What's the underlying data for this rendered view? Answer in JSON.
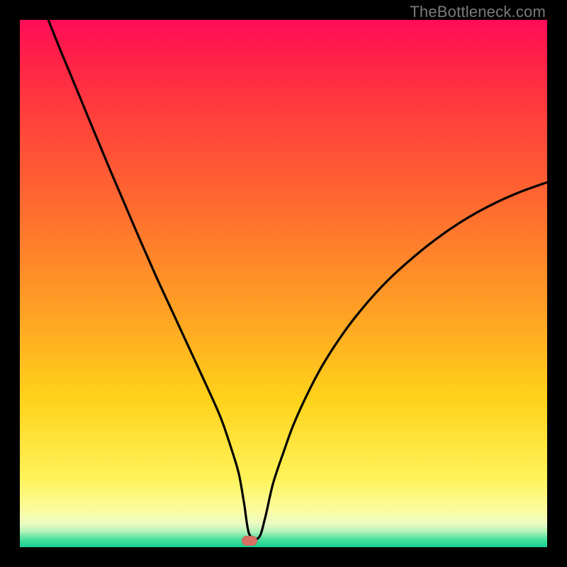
{
  "watermark": "TheBottleneck.com",
  "marker": {
    "x_frac": 0.435,
    "y_frac": 0.988
  },
  "chart_data": {
    "type": "line",
    "title": "",
    "xlabel": "",
    "ylabel": "",
    "xlim": [
      0,
      1
    ],
    "ylim": [
      0,
      1
    ],
    "series": [
      {
        "name": "curve",
        "x": [
          0.054,
          0.08,
          0.11,
          0.14,
          0.17,
          0.2,
          0.23,
          0.26,
          0.29,
          0.32,
          0.35,
          0.38,
          0.4,
          0.415,
          0.425,
          0.435,
          0.453,
          0.465,
          0.48,
          0.5,
          0.52,
          0.55,
          0.58,
          0.62,
          0.66,
          0.7,
          0.75,
          0.8,
          0.85,
          0.9,
          0.95,
          1.0
        ],
        "y": [
          1.0,
          0.935,
          0.863,
          0.79,
          0.718,
          0.648,
          0.578,
          0.51,
          0.445,
          0.38,
          0.315,
          0.248,
          0.19,
          0.14,
          0.085,
          0.025,
          0.018,
          0.055,
          0.12,
          0.18,
          0.235,
          0.3,
          0.355,
          0.415,
          0.465,
          0.508,
          0.553,
          0.592,
          0.625,
          0.652,
          0.674,
          0.692
        ]
      }
    ],
    "annotations": [
      {
        "type": "marker",
        "x": 0.435,
        "y": 0.012,
        "label": "min-point"
      }
    ],
    "gradient_stops": [
      {
        "pos": 0.0,
        "color": "#ff0d58"
      },
      {
        "pos": 0.18,
        "color": "#ff3f3c"
      },
      {
        "pos": 0.55,
        "color": "#ffa024"
      },
      {
        "pos": 0.87,
        "color": "#fff35a"
      },
      {
        "pos": 0.97,
        "color": "#b6f3ba"
      },
      {
        "pos": 1.0,
        "color": "#16d292"
      }
    ]
  }
}
